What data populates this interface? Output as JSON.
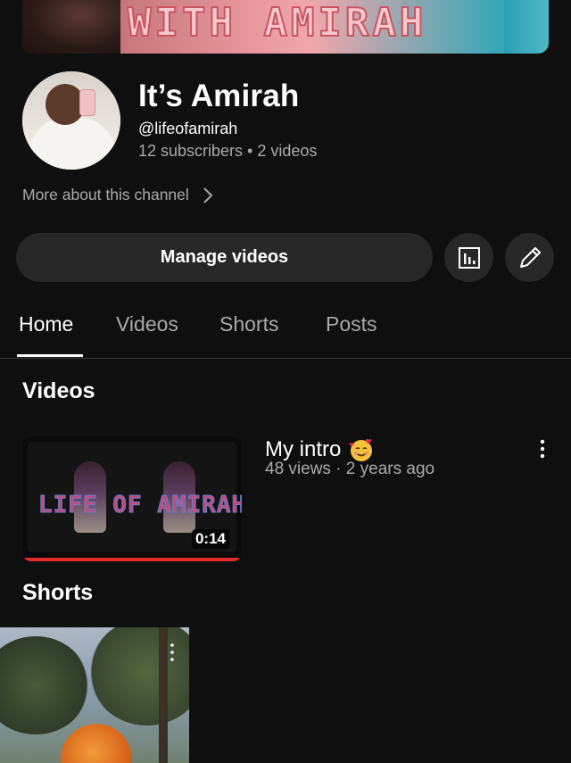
{
  "banner": {
    "text": "WITH AMIRAH"
  },
  "channel": {
    "name": "It’s Amirah",
    "handle": "@lifeofamirah",
    "stats": "12 subscribers • 2 videos",
    "more_about": "More about this channel"
  },
  "actions": {
    "manage_videos": "Manage videos",
    "analytics_icon": "analytics-icon",
    "edit_icon": "pencil-icon"
  },
  "tabs": [
    {
      "label": "Home",
      "active": true
    },
    {
      "label": "Videos",
      "active": false
    },
    {
      "label": "Shorts",
      "active": false
    },
    {
      "label": "Posts",
      "active": false
    }
  ],
  "sections": {
    "videos": {
      "title": "Videos",
      "items": [
        {
          "title": "My intro",
          "emoji": "smiling-face-with-hearts",
          "meta": "48 views · 2 years ago",
          "duration": "0:14",
          "thumbnail_text": "LIFE OF AMIRAH",
          "watched_fraction": 1.0
        }
      ]
    },
    "shorts": {
      "title": "Shorts"
    }
  },
  "colors": {
    "background": "#0f0f0f",
    "button_bg": "#272727",
    "secondary_text": "#aaaaaa",
    "progress": "#e12a2a"
  }
}
